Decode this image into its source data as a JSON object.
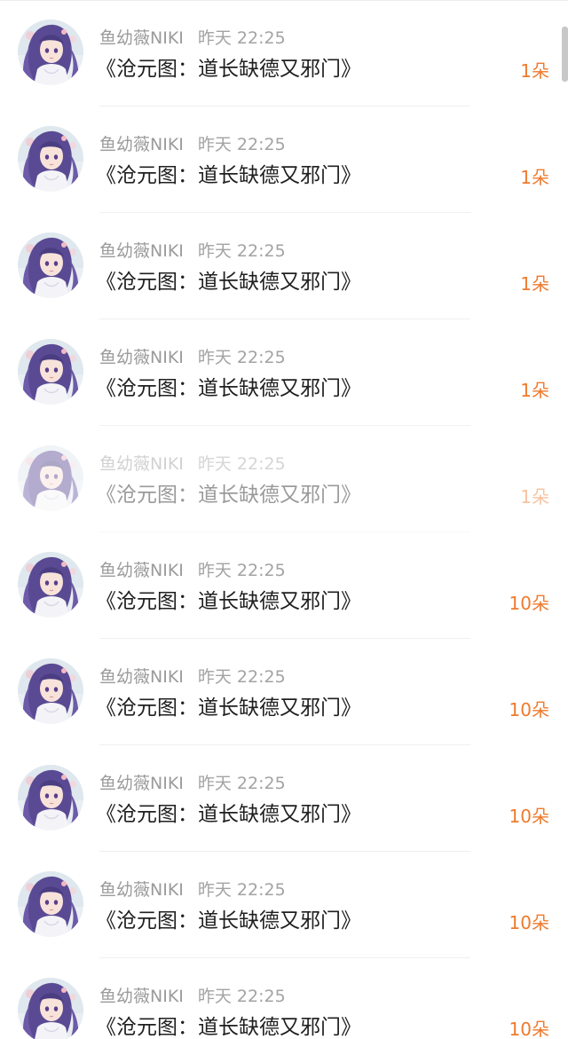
{
  "rows": [
    {
      "user": "鱼幼薇NIKI",
      "time": "昨天 22:25",
      "title": "《沧元图：道长缺德又邪门》",
      "amount": "1朵",
      "state": "normal"
    },
    {
      "user": "鱼幼薇NIKI",
      "time": "昨天 22:25",
      "title": "《沧元图：道长缺德又邪门》",
      "amount": "1朵",
      "state": "normal"
    },
    {
      "user": "鱼幼薇NIKI",
      "time": "昨天 22:25",
      "title": "《沧元图：道长缺德又邪门》",
      "amount": "1朵",
      "state": "normal"
    },
    {
      "user": "鱼幼薇NIKI",
      "time": "昨天 22:25",
      "title": "《沧元图：道长缺德又邪门》",
      "amount": "1朵",
      "state": "normal"
    },
    {
      "user": "鱼幼薇NIKI",
      "time": "昨天 22:25",
      "title": "《沧元图：道长缺德又邪门》",
      "amount": "1朵",
      "state": "faded"
    },
    {
      "user": "鱼幼薇NIKI",
      "time": "昨天 22:25",
      "title": "《沧元图：道长缺德又邪门》",
      "amount": "10朵",
      "state": "normal"
    },
    {
      "user": "鱼幼薇NIKI",
      "time": "昨天 22:25",
      "title": "《沧元图：道长缺德又邪门》",
      "amount": "10朵",
      "state": "normal"
    },
    {
      "user": "鱼幼薇NIKI",
      "time": "昨天 22:25",
      "title": "《沧元图：道长缺德又邪门》",
      "amount": "10朵",
      "state": "normal"
    },
    {
      "user": "鱼幼薇NIKI",
      "time": "昨天 22:25",
      "title": "《沧元图：道长缺德又邪门》",
      "amount": "10朵",
      "state": "normal"
    },
    {
      "user": "鱼幼薇NIKI",
      "time": "昨天 22:25",
      "title": "《沧元图：道长缺德又邪门》",
      "amount": "10朵",
      "state": "normal"
    }
  ],
  "colors": {
    "amount": "#ef7a2d",
    "meta": "#9b9b9b",
    "title": "#1f1f1f"
  },
  "avatar_icon": "anime-girl-avatar"
}
